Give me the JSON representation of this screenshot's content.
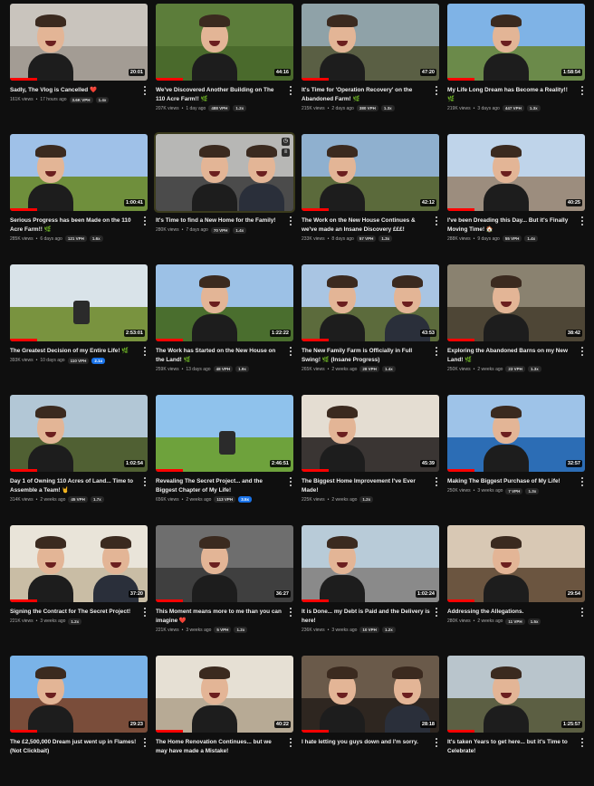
{
  "videos": [
    {
      "title": "Sadly, The Vlog is Cancelled ❤️",
      "views": "161K views",
      "age": "17 hours ago",
      "vph": "3.6K VPH",
      "ratio": "1.4x",
      "duration": "20:01",
      "progress": 0.2,
      "colors": [
        "#c9c4bd",
        "#a39c94"
      ],
      "faces": 1
    },
    {
      "title": "We've Discovered Another Building on The 110 Acre Farm!! 🌿",
      "views": "207K views",
      "age": "1 day ago",
      "vph": "488 VPH",
      "ratio": "1.2x",
      "duration": "44:16",
      "progress": 0.2,
      "colors": [
        "#5c7d3a",
        "#4a6a2c"
      ],
      "faces": 1
    },
    {
      "title": "It's Time for 'Operation Recovery' on the Abandoned Farm! 🌿",
      "views": "215K views",
      "age": "2 days ago",
      "vph": "380 VPH",
      "ratio": "1.3x",
      "duration": "47:20",
      "progress": 0.2,
      "colors": [
        "#8fa2a8",
        "#5a5f44"
      ],
      "faces": 1
    },
    {
      "title": "My Life Long Dream has Become a Reality!! 🌿",
      "views": "219K views",
      "age": "3 days ago",
      "vph": "447 VPH",
      "ratio": "1.3x",
      "duration": "1:58:54",
      "progress": 0.2,
      "colors": [
        "#7fb3e6",
        "#6b8a4a"
      ],
      "faces": 1
    },
    {
      "title": "Serious Progress has been Made on the 110 Acre Farm!! 🌿",
      "views": "285K views",
      "age": "6 days ago",
      "vph": "121 VPH",
      "ratio": "1.6x",
      "duration": "1:00:41",
      "progress": 0.2,
      "colors": [
        "#9fc1e8",
        "#6f8f3c"
      ],
      "faces": 1
    },
    {
      "title": "It's Time to find a New Home for the Family!",
      "views": "280K views",
      "age": "7 days ago",
      "vph": "70 VPH",
      "ratio": "1.4x",
      "duration": "",
      "progress": 0.0,
      "colors": [
        "#b7b7b5",
        "#4b4b4b"
      ],
      "faces": 2,
      "hovered": true
    },
    {
      "title": "The Work on the New House Continues & we've made an Insane Discovery £££!",
      "views": "233K views",
      "age": "8 days ago",
      "vph": "57 VPH",
      "ratio": "1.3x",
      "duration": "42:12",
      "progress": 0.2,
      "colors": [
        "#8fb0cf",
        "#5b6a3b"
      ],
      "faces": 1
    },
    {
      "title": "I've been Dreading this Day... But it's Finally Moving Time! 🏠",
      "views": "288K views",
      "age": "9 days ago",
      "vph": "55 VPH",
      "ratio": "1.4x",
      "duration": "40:25",
      "progress": 0.2,
      "colors": [
        "#bfd4ea",
        "#9c8d7e"
      ],
      "faces": 1
    },
    {
      "title": "The Greatest Decision of my Entire Life! 🌿",
      "views": "393K views",
      "age": "10 days ago",
      "vph": "110 VPH",
      "ratio": "2.1x",
      "ratio_hot": true,
      "duration": "2:53:01",
      "progress": 0.2,
      "colors": [
        "#d9e3e9",
        "#79933f"
      ],
      "faces": 0
    },
    {
      "title": "The Work has Started on the New House on the Land! 🌿",
      "views": "259K views",
      "age": "13 days ago",
      "vph": "48 VPH",
      "ratio": "1.9x",
      "duration": "1:22:22",
      "progress": 0.2,
      "colors": [
        "#9cc1e6",
        "#4a6e2e"
      ],
      "faces": 1
    },
    {
      "title": "The New Family Farm is Officially in Full Swing! 🌿 (Insane Progress)",
      "views": "265K views",
      "age": "2 weeks ago",
      "vph": "28 VPH",
      "ratio": "1.4x",
      "duration": "43:53",
      "progress": 0.2,
      "colors": [
        "#a9c5e3",
        "#5c6b3c"
      ],
      "faces": 2
    },
    {
      "title": "Exploring the Abandoned Barns on my New Land! 🌿",
      "views": "250K views",
      "age": "2 weeks ago",
      "vph": "23 VPH",
      "ratio": "1.3x",
      "duration": "38:42",
      "progress": 0.2,
      "colors": [
        "#8a8270",
        "#4e4636"
      ],
      "faces": 1
    },
    {
      "title": "Day 1 of Owning 110 Acres of Land... Time to Assemble a Team! 🤘",
      "views": "314K views",
      "age": "2 weeks ago",
      "vph": "45 VPH",
      "ratio": "1.7x",
      "duration": "1:02:54",
      "progress": 0.2,
      "colors": [
        "#b2c7d6",
        "#506033"
      ],
      "faces": 1
    },
    {
      "title": "Revealing The Secret Project... and the Biggest Chapter of My Life!",
      "views": "656K views",
      "age": "2 weeks ago",
      "vph": "113 VPH",
      "ratio": "3.5x",
      "ratio_hot": true,
      "duration": "2:46:51",
      "progress": 0.2,
      "colors": [
        "#8fc2ec",
        "#6ea23c"
      ],
      "faces": 0
    },
    {
      "title": "The Biggest Home Improvement I've Ever Made!",
      "views": "225K views",
      "age": "2 weeks ago",
      "vph": "",
      "ratio": "1.2x",
      "duration": "45:39",
      "progress": 0.2,
      "colors": [
        "#e4ddd2",
        "#3a3533"
      ],
      "faces": 1
    },
    {
      "title": "Making The Biggest Purchase of My Life!",
      "views": "250K views",
      "age": "3 weeks ago",
      "vph": "7 VPH",
      "ratio": "1.3x",
      "duration": "32:57",
      "progress": 0.2,
      "colors": [
        "#9ec3e8",
        "#2c6db5"
      ],
      "faces": 1
    },
    {
      "title": "Signing the Contract for The Secret Project!",
      "views": "221K views",
      "age": "3 weeks ago",
      "vph": "",
      "ratio": "1.2x",
      "duration": "37:20",
      "progress": 0.2,
      "colors": [
        "#e9e4d9",
        "#c9bda5"
      ],
      "faces": 2
    },
    {
      "title": "This Moment means more to me than you can imagine ❤️",
      "views": "221K views",
      "age": "3 weeks ago",
      "vph": "5 VPH",
      "ratio": "1.2x",
      "duration": "36:27",
      "progress": 0.2,
      "colors": [
        "#6e6e6e",
        "#3f3f3f"
      ],
      "faces": 1
    },
    {
      "title": "It is Done... my Debt is Paid and the Delivery is here!",
      "views": "236K views",
      "age": "3 weeks ago",
      "vph": "10 VPH",
      "ratio": "1.2x",
      "duration": "1:02:24",
      "progress": 0.2,
      "colors": [
        "#b8cbd8",
        "#8a8a8a"
      ],
      "faces": 1
    },
    {
      "title": "Addressing the Allegations.",
      "views": "280K views",
      "age": "2 weeks ago",
      "vph": "11 VPH",
      "ratio": "1.5x",
      "duration": "29:54",
      "progress": 0.2,
      "colors": [
        "#d8c8b4",
        "#6b5540"
      ],
      "faces": 1
    },
    {
      "title": "The £2,500,000 Dream just went up in Flames! (Not Clickbait)",
      "views": "",
      "age": "",
      "vph": "",
      "ratio": "",
      "duration": "29:23",
      "progress": 0.2,
      "colors": [
        "#7ab3e8",
        "#7a4d3a"
      ],
      "faces": 1
    },
    {
      "title": "The Home Renovation Continues... but we may have made a Mistake!",
      "views": "",
      "age": "",
      "vph": "",
      "ratio": "",
      "duration": "40:22",
      "progress": 0.2,
      "colors": [
        "#e6e0d4",
        "#b7aa95"
      ],
      "faces": 1
    },
    {
      "title": "I hate letting you guys down and I'm sorry.",
      "views": "",
      "age": "",
      "vph": "",
      "ratio": "",
      "duration": "28:18",
      "progress": 0.2,
      "colors": [
        "#6a5a4a",
        "#2e2620"
      ],
      "faces": 2
    },
    {
      "title": "It's taken Years to get here... but it's Time to Celebrate!",
      "views": "",
      "age": "",
      "vph": "",
      "ratio": "",
      "duration": "1:25:57",
      "progress": 0.2,
      "colors": [
        "#b9c5cc",
        "#5c5f43"
      ],
      "faces": 1
    }
  ],
  "hover_icons": [
    "clock-icon",
    "queue-icon"
  ]
}
